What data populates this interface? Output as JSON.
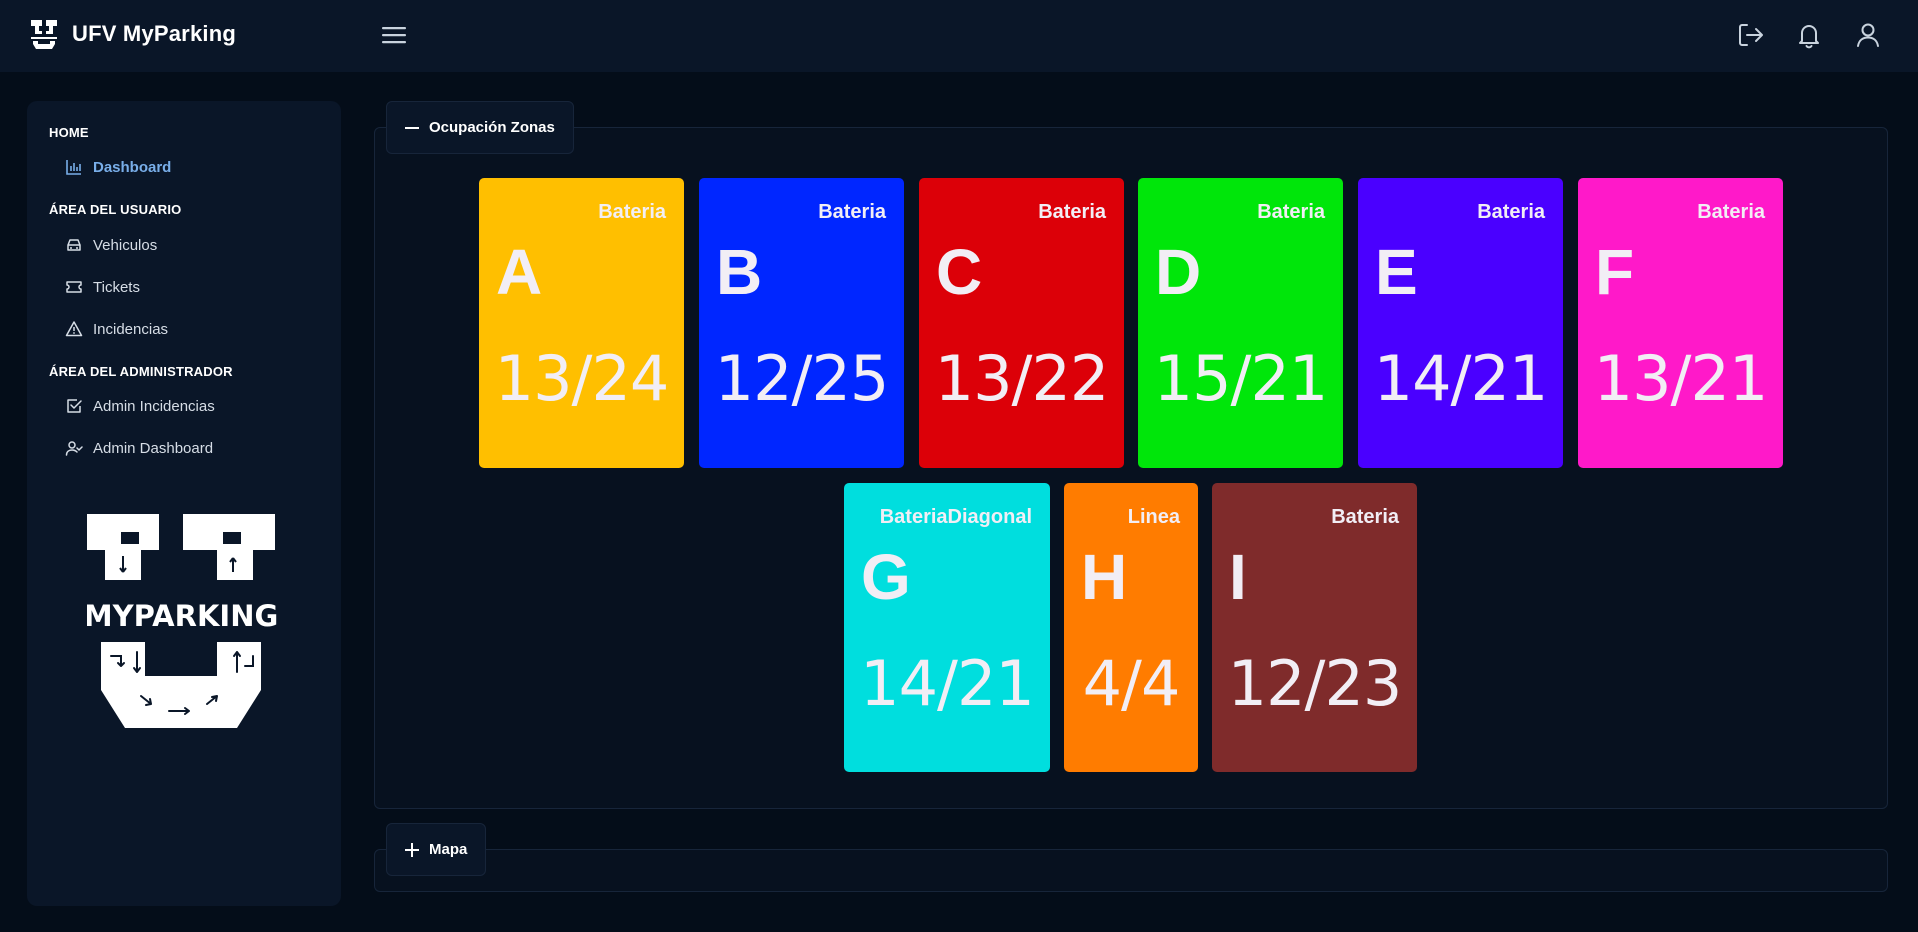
{
  "app": {
    "title": "UFV MyParking"
  },
  "header": {
    "icons": [
      "menu-icon",
      "logout-icon",
      "bell-icon",
      "user-icon"
    ]
  },
  "sidebar": {
    "sections": [
      {
        "heading": "HOME",
        "items": [
          {
            "label": "Dashboard",
            "icon": "bar-chart-icon",
            "active": true
          }
        ]
      },
      {
        "heading": "ÁREA DEL USUARIO",
        "items": [
          {
            "label": "Vehiculos",
            "icon": "car-icon"
          },
          {
            "label": "Tickets",
            "icon": "ticket-icon"
          },
          {
            "label": "Incidencias",
            "icon": "warning-icon"
          }
        ]
      },
      {
        "heading": "ÁREA DEL ADMINISTRADOR",
        "items": [
          {
            "label": "Admin Incidencias",
            "icon": "checkbox-icon"
          },
          {
            "label": "Admin Dashboard",
            "icon": "user-check-icon"
          }
        ]
      }
    ],
    "logo_text": "MYPARKING"
  },
  "occupancy_panel": {
    "tab_label": "Ocupación Zonas",
    "zones": [
      {
        "letter": "A",
        "type": "Bateria",
        "count": "13/24",
        "color": "#ffbf00"
      },
      {
        "letter": "B",
        "type": "Bateria",
        "count": "12/25",
        "color": "#0026ff"
      },
      {
        "letter": "C",
        "type": "Bateria",
        "count": "13/22",
        "color": "#dc0008"
      },
      {
        "letter": "D",
        "type": "Bateria",
        "count": "15/21",
        "color": "#00e60a"
      },
      {
        "letter": "E",
        "type": "Bateria",
        "count": "14/21",
        "color": "#4a00ff"
      },
      {
        "letter": "F",
        "type": "Bateria",
        "count": "13/21",
        "color": "#ff19c9"
      },
      {
        "letter": "G",
        "type": "BateriaDiagonal",
        "count": "14/21",
        "color": "#00dede"
      },
      {
        "letter": "H",
        "type": "Linea",
        "count": "4/4",
        "color": "#ff7c00"
      },
      {
        "letter": "I",
        "type": "Bateria",
        "count": "12/23",
        "color": "#7f2b2b"
      }
    ]
  },
  "map_panel": {
    "tab_label": "Mapa"
  }
}
